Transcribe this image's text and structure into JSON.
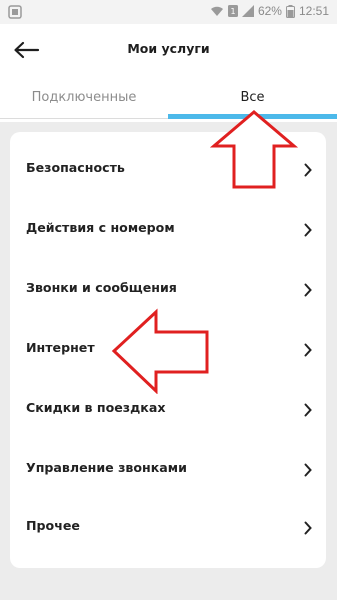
{
  "status_bar": {
    "battery_percent": "62%",
    "time": "12:51"
  },
  "header": {
    "title": "Мои услуги"
  },
  "tabs": [
    {
      "label": "Подключенные",
      "active": false
    },
    {
      "label": "Все",
      "active": true
    }
  ],
  "colors": {
    "tab_accent": "#4cb9ea",
    "annotation_arrow": "#e02020",
    "background": "#ececec"
  },
  "services": [
    {
      "label": "Безопасность"
    },
    {
      "label": "Действия с номером"
    },
    {
      "label": "Звонки и сообщения"
    },
    {
      "label": "Интернет"
    },
    {
      "label": "Скидки в поездках"
    },
    {
      "label": "Управление звонками"
    },
    {
      "label": "Прочее"
    }
  ]
}
